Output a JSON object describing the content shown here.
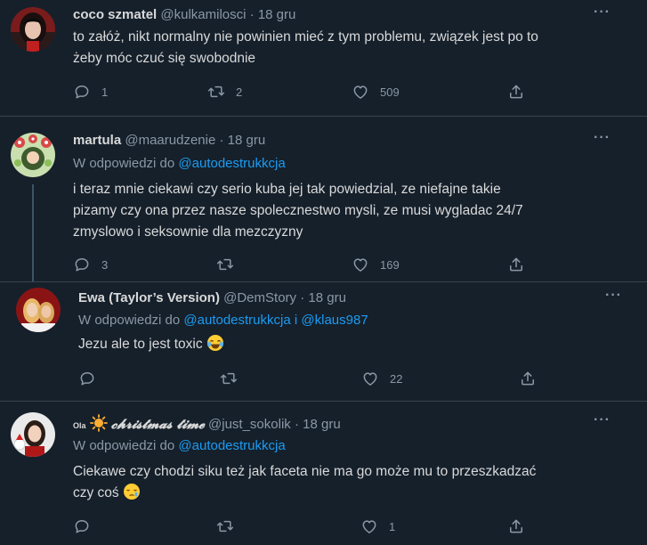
{
  "tweets": [
    {
      "name": "coco szmatel",
      "handle": "@kulkamilosci",
      "date": "18 gru",
      "body_lines": [
        "to załóż, nikt normalny nie powinien mieć z tym problemu, związek jest po to",
        "żeby móc czuć się swobodnie"
      ],
      "replies": "1",
      "retweets": "2",
      "likes": "509"
    },
    {
      "name": "martula",
      "handle": "@maarudzenie",
      "date": "18 gru",
      "reply_prefix": "W odpowiedzi do",
      "reply_mention": "@autodestrukkcja",
      "body_lines": [
        "i teraz mnie ciekawi czy serio kuba jej tak powiedzial, ze niefajne takie",
        "pizamy czy ona przez nasze spolecznestwo mysli, ze musi wygladac 24/7",
        "zmyslowo i seksownie dla mezczyzny"
      ],
      "replies": "3",
      "retweets": "",
      "likes": "169"
    },
    {
      "name": "Ewa (Taylor’s Version)",
      "handle": "@DemStory",
      "date": "18 gru",
      "reply_prefix": "W odpowiedzi do",
      "reply_mention": "@autodestrukkcja",
      "reply_joiner": "i",
      "reply_mention2": "@klaus987",
      "body_lines": [
        "Jezu ale to jest toxic"
      ],
      "replies": "",
      "retweets": "",
      "likes": "22"
    },
    {
      "name_prefix": "Ola",
      "name": "𝓬𝓱𝓻𝓲𝓼𝓽𝓶𝓪𝓼 𝓽𝓲𝓶𝓮",
      "handle": "@just_sokolik",
      "date": "18 gru",
      "reply_prefix": "W odpowiedzi do",
      "reply_mention": "@autodestrukkcja",
      "body_lines": [
        "Ciekawe czy chodzi siku też jak faceta nie ma go może mu to przeszkadzać",
        "czy coś"
      ],
      "replies": "",
      "retweets": "",
      "likes": "1"
    }
  ],
  "separator_dot": "·",
  "colors": {
    "background": "#15202b",
    "text": "#d9d9d9",
    "muted": "#8b98a5",
    "link": "#1d9bf0",
    "border": "#38444d"
  },
  "icons": {
    "reply": "reply-icon",
    "retweet": "retweet-icon",
    "like": "heart-icon",
    "share": "share-icon",
    "more": "more-icon"
  }
}
